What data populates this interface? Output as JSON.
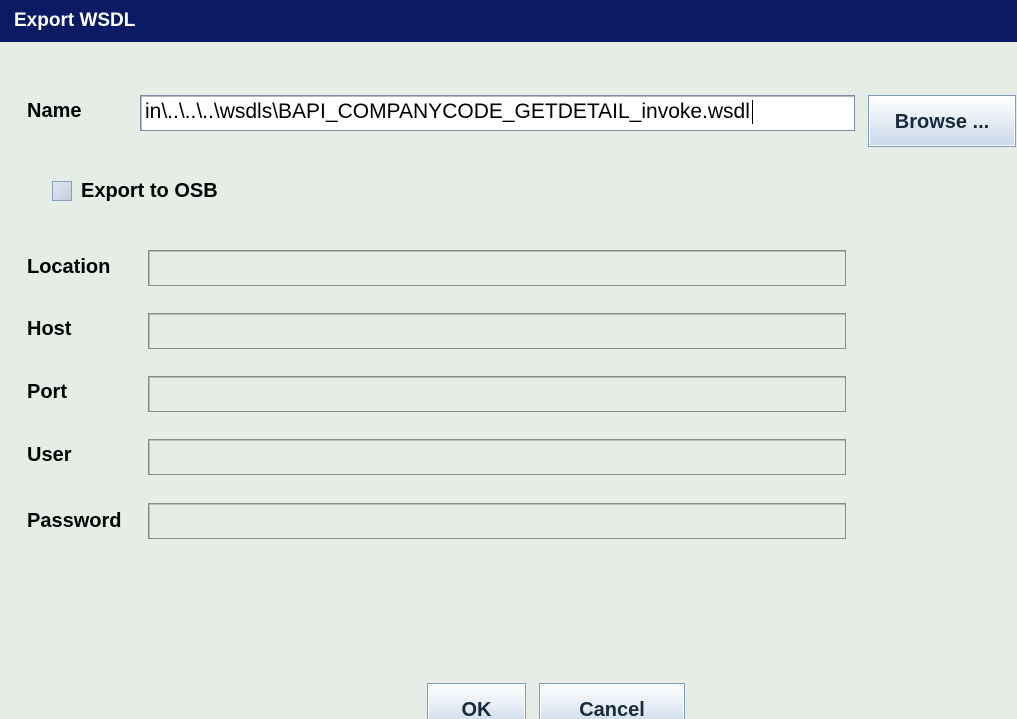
{
  "dialog": {
    "title": "Export WSDL"
  },
  "name_field": {
    "label": "Name",
    "value": "in\\..\\..\\..\\wsdls\\BAPI_COMPANYCODE_GETDETAIL_invoke.wsdl"
  },
  "browse_button": {
    "label": "Browse ..."
  },
  "export_osb": {
    "label": "Export to OSB",
    "checked": false
  },
  "fields": [
    {
      "label": "Location",
      "value": ""
    },
    {
      "label": "Host",
      "value": ""
    },
    {
      "label": "Port",
      "value": ""
    },
    {
      "label": "User",
      "value": ""
    },
    {
      "label": "Password",
      "value": ""
    }
  ],
  "buttons": {
    "ok_label": "OK",
    "cancel_label": "Cancel"
  },
  "colors": {
    "titlebar": "#0a1a64",
    "background": "#e6ece6"
  }
}
